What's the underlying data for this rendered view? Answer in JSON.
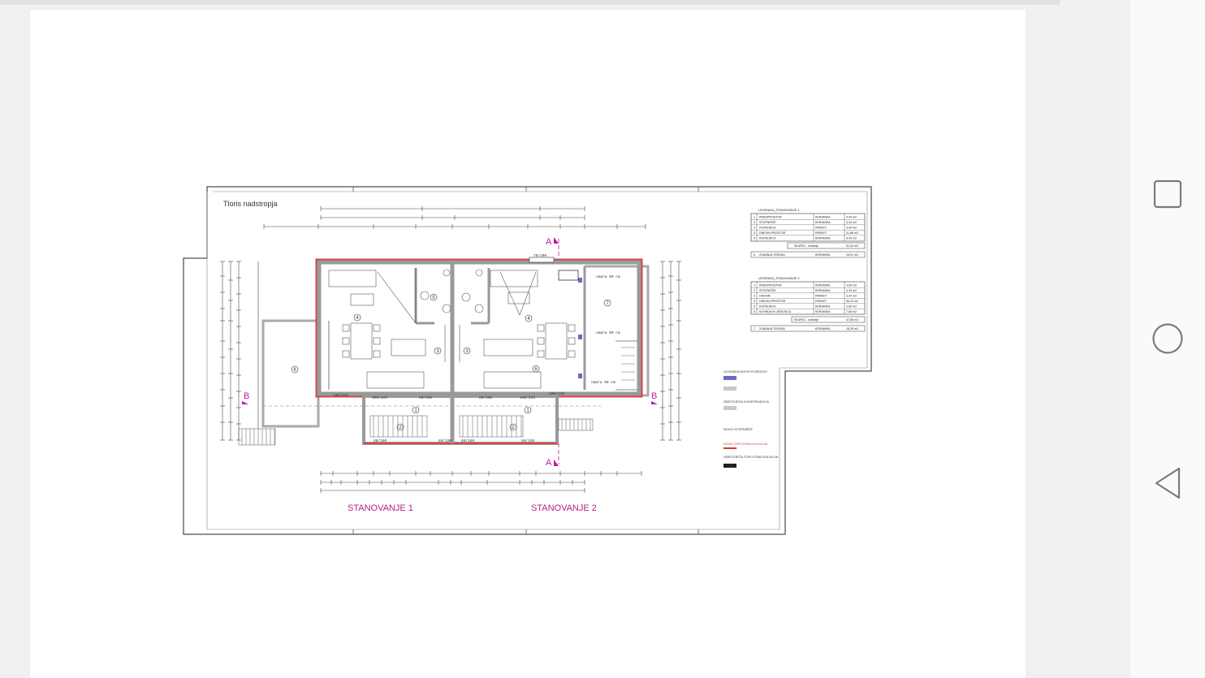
{
  "drawing": {
    "sheet_title": "Tloris nadstropja",
    "apartment_labels": [
      "STANOVANJE 1",
      "STANOVANJE 2"
    ],
    "section_marks": {
      "a": "A",
      "b": "B"
    },
    "room_numbers": [
      "1",
      "2",
      "3",
      "4",
      "5",
      "6",
      "7"
    ],
    "openings": [
      "160/220",
      "100/220",
      "80/200",
      "120/220",
      "80/190",
      "80/100",
      "80/100",
      "80/190",
      "100/220",
      "160/220",
      "160/220",
      "70/200"
    ],
    "notes": [
      "omara 60 cm",
      "omara 60 cm",
      "omara 60 cm"
    ]
  },
  "legend_apt1": {
    "title": "LEGENDA_STANOVANJE 1",
    "rows": [
      {
        "n": "1",
        "name": "PREDPROSTOR",
        "floor": "KERAMIKA",
        "area": "4,94 m2"
      },
      {
        "n": "2",
        "name": "STOPNIŠČE",
        "floor": "KERAMIKA",
        "area": "4,33 m2"
      },
      {
        "n": "3",
        "name": "KOPALNICA",
        "floor": "PARKET",
        "area": "3,44 m2"
      },
      {
        "n": "4",
        "name": "DNEVNI PROSTOR",
        "floor": "PARKET",
        "area": "31,88 m2"
      },
      {
        "n": "5",
        "name": "KOPALNICA",
        "floor": "KERAMIKA",
        "area": "4,49 m2"
      }
    ],
    "total_label": "SKUPAJ - notranje",
    "total_value": "51,04 m2",
    "terrace": {
      "n": "6",
      "name": "ZUNANJA TERASA",
      "floor": "KERAMIKA",
      "area": "16,91 m2"
    }
  },
  "legend_apt2": {
    "title": "LEGENDA_STANOVANJE 2",
    "rows": [
      {
        "n": "1",
        "name": "PREDPROSTOR",
        "floor": "KERAMIKA",
        "area": "4,94 m2"
      },
      {
        "n": "2",
        "name": "STOPNIŠČE",
        "floor": "KERAMIKA",
        "area": "4,33 m2"
      },
      {
        "n": "3",
        "name": "HODNIK",
        "floor": "PARKET",
        "area": "3,44 m2"
      },
      {
        "n": "4",
        "name": "DNEVNI PROSTOR",
        "floor": "PARKET",
        "area": "30,23 m2"
      },
      {
        "n": "5",
        "name": "KOPALNICA",
        "floor": "KERAMIKA",
        "area": "3,60 m2"
      },
      {
        "n": "6",
        "name": "KUHINJA IN JEDILNICA",
        "floor": "KERAMIKA",
        "area": "7,68 m2"
      }
    ],
    "total_label": "SKUPAJ - notranje",
    "total_value": "47,85 m2",
    "terrace": {
      "n": "7",
      "name": "ZUNANJA TERASA",
      "floor": "KERAMIKA",
      "area": "18,28 m2"
    }
  },
  "legend_walls": {
    "title": "LEGENDA NOVIH POSEGOV",
    "items": [
      "OBSTOJEČA KONSTRUKCIJA",
      "NOVO STOPNIŠČE",
      "NOVA TOPLOTNA IZOLACIJA",
      "OBSTOJEČA TOPLOTNA IZOLACIJA"
    ],
    "colors": {
      "new_wall": "#6c6ac6",
      "existing": "#c9c9c9",
      "new_insulation": "#d03b3b",
      "existing_insulation": "#222222"
    }
  },
  "accent_colors": {
    "magenta": "#c2189b",
    "apartment_label": "#b2218a",
    "wall_fill": "#9a9a9a",
    "insulation": "#d64545"
  },
  "navigation": {
    "buttons": [
      {
        "name": "recent-apps-button",
        "icon": "square-icon"
      },
      {
        "name": "home-button",
        "icon": "circle-icon"
      },
      {
        "name": "back-button",
        "icon": "triangle-back-icon"
      }
    ]
  }
}
